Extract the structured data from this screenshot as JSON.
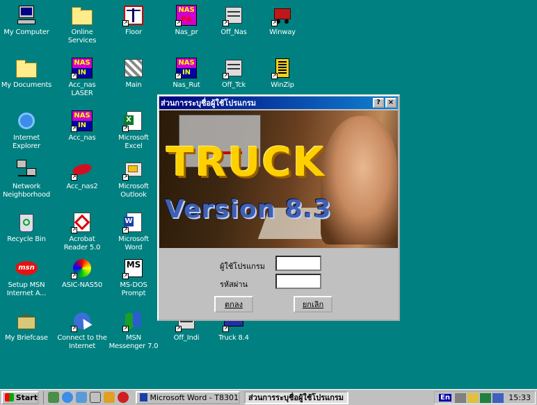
{
  "desktop_icons": [
    {
      "label": "My Computer",
      "icon": "computer-icon"
    },
    {
      "label": "Online Services",
      "icon": "folder-icon"
    },
    {
      "label": "Floor",
      "icon": "scale-icon"
    },
    {
      "label": "Nas_pr",
      "icon": "nas-pr-icon",
      "top": "NAS",
      "bottom": "PR"
    },
    {
      "label": "Off_Nas",
      "icon": "form-icon"
    },
    {
      "label": "Winway",
      "icon": "truck-icon"
    },
    {
      "label": "My Documents",
      "icon": "open-folder-icon"
    },
    {
      "label": "Acc_nas LASER",
      "icon": "nas-in-icon",
      "top": "NAS",
      "bottom": "IN"
    },
    {
      "label": "Main",
      "icon": "pattern-icon"
    },
    {
      "label": "Nas_Rut",
      "icon": "nas-in-icon",
      "top": "NAS",
      "bottom": "IN"
    },
    {
      "label": "Off_Tck",
      "icon": "form-icon"
    },
    {
      "label": "WinZip",
      "icon": "winzip-icon"
    },
    {
      "label": "Internet Explorer",
      "icon": "ie-icon"
    },
    {
      "label": "Acc_nas",
      "icon": "nas-in-icon",
      "top": "NAS",
      "bottom": "IN"
    },
    {
      "label": "Microsoft Excel",
      "icon": "excel-icon"
    },
    {
      "label": "Network Neighborhood",
      "icon": "network-icon"
    },
    {
      "label": "Acc_nas2",
      "icon": "lips-icon"
    },
    {
      "label": "Microsoft Outlook",
      "icon": "outlook-icon"
    },
    {
      "label": "Recycle Bin",
      "icon": "recycle-bin-icon"
    },
    {
      "label": "Acrobat Reader 5.0",
      "icon": "acrobat-icon"
    },
    {
      "label": "Microsoft Word",
      "icon": "word-icon"
    },
    {
      "label": "Setup MSN Internet A...",
      "icon": "msn-icon",
      "text": "msn"
    },
    {
      "label": "ASIC-NAS50",
      "icon": "ball-icon"
    },
    {
      "label": "MS-DOS Prompt",
      "icon": "msdos-icon",
      "text": "MS"
    },
    {
      "label": "My Briefcase",
      "icon": "briefcase-icon"
    },
    {
      "label": "Connect to the Internet",
      "icon": "connect-icon"
    },
    {
      "label": "MSN Messenger 7.0",
      "icon": "messenger-icon"
    },
    {
      "label": "Off_Indi",
      "icon": "form-icon"
    },
    {
      "label": "Truck 8.4",
      "icon": "truck-app-icon"
    }
  ],
  "window": {
    "title": "ส่วนการระบุชื่อผู้ใช้โปรแกรม",
    "help_label": "?",
    "close_label": "×",
    "splash_title": "TRUCK",
    "splash_version": "Version 8.3",
    "user_label": "ผู้ใช้โปรแกรม",
    "user_value": "",
    "password_label": "รหัสผ่าน",
    "password_value": "",
    "ok_label": "ตกลง",
    "cancel_label": "ยกเลิก"
  },
  "taskbar": {
    "start_label": "Start",
    "tasks": [
      {
        "label": "Microsoft Word - T8301",
        "active": false
      },
      {
        "label": "ส่วนการระบุชื่อผู้ใช้โปรแกรม",
        "active": true
      }
    ],
    "lang": "En",
    "clock": "15:33"
  },
  "colors": {
    "desktop": "#008080",
    "titlebar": "#000080",
    "face": "#c0c0c0"
  }
}
